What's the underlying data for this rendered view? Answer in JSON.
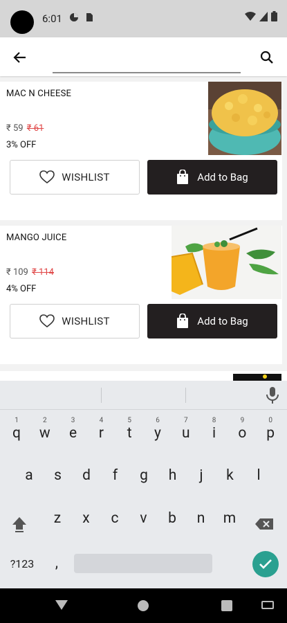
{
  "status": {
    "time": "6:01"
  },
  "appbar": {
    "search_value": "",
    "search_placeholder": ""
  },
  "products": [
    {
      "name": "MAC N CHEESE",
      "price": "₹ 59",
      "mrp": "₹ 61",
      "discount": "3% OFF",
      "wishlist_label": "WISHLIST",
      "bag_label": "Add to Bag"
    },
    {
      "name": "MANGO JUICE",
      "price": "₹ 109",
      "mrp": "₹ 114",
      "discount": "4% OFF",
      "wishlist_label": "WISHLIST",
      "bag_label": "Add to Bag"
    }
  ],
  "keyboard": {
    "row1": [
      {
        "k": "q",
        "h": "1"
      },
      {
        "k": "w",
        "h": "2"
      },
      {
        "k": "e",
        "h": "3"
      },
      {
        "k": "r",
        "h": "4"
      },
      {
        "k": "t",
        "h": "5"
      },
      {
        "k": "y",
        "h": "6"
      },
      {
        "k": "u",
        "h": "7"
      },
      {
        "k": "i",
        "h": "8"
      },
      {
        "k": "o",
        "h": "9"
      },
      {
        "k": "p",
        "h": "0"
      }
    ],
    "row2": [
      "a",
      "s",
      "d",
      "f",
      "g",
      "h",
      "j",
      "k",
      "l"
    ],
    "row3": [
      "z",
      "x",
      "c",
      "v",
      "b",
      "n",
      "m"
    ],
    "symbols_label": "?123",
    "comma_label": ","
  },
  "colors": {
    "accent": "#231f20",
    "old_price": "#e04848",
    "enter": "#2aa090"
  }
}
